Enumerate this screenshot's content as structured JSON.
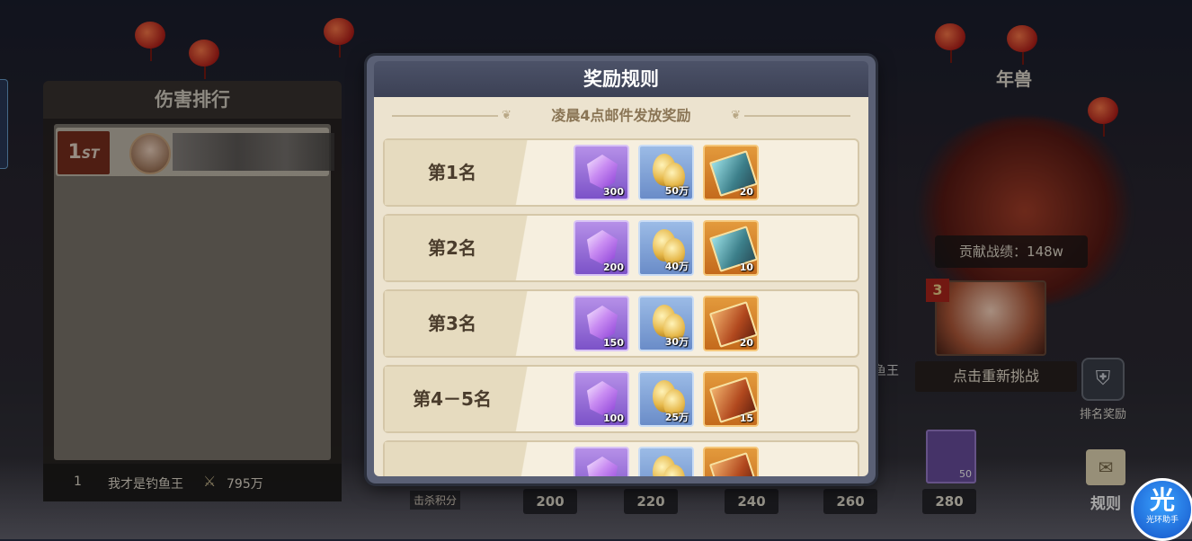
{
  "rank_panel": {
    "title": "伤害排行",
    "top_entry": {
      "badge": "1",
      "badge_suffix": "ST"
    },
    "footer": {
      "rank": "1",
      "name": "我才是钓鱼王",
      "damage": "795万"
    }
  },
  "side": {
    "boss_title": "年兽",
    "contribution": "贡献战绩：148w",
    "portrait_rank": "3",
    "retry_label": "点击重新挑战",
    "rank_reward_label": "排名奖励",
    "rules_label": "规则",
    "fishking_fragment": "鱼王",
    "item_qty": "50"
  },
  "progress": {
    "kill_label": "击杀积分",
    "scores": [
      "200",
      "220",
      "240",
      "260",
      "280"
    ]
  },
  "helper": {
    "glyph": "光",
    "text": "光环助手"
  },
  "modal": {
    "title": "奖励规则",
    "subtitle": "凌晨4点邮件发放奖励",
    "rows": [
      {
        "label": "第1名",
        "gem": "300",
        "coin": "50万",
        "card": "20",
        "card_style": "a"
      },
      {
        "label": "第2名",
        "gem": "200",
        "coin": "40万",
        "card": "10",
        "card_style": "a"
      },
      {
        "label": "第3名",
        "gem": "150",
        "coin": "30万",
        "card": "20",
        "card_style": "b"
      },
      {
        "label": "第4－5名",
        "gem": "100",
        "coin": "25万",
        "card": "15",
        "card_style": "b"
      },
      {
        "label": "",
        "gem": "",
        "coin": "",
        "card": "",
        "card_style": "b"
      }
    ]
  }
}
